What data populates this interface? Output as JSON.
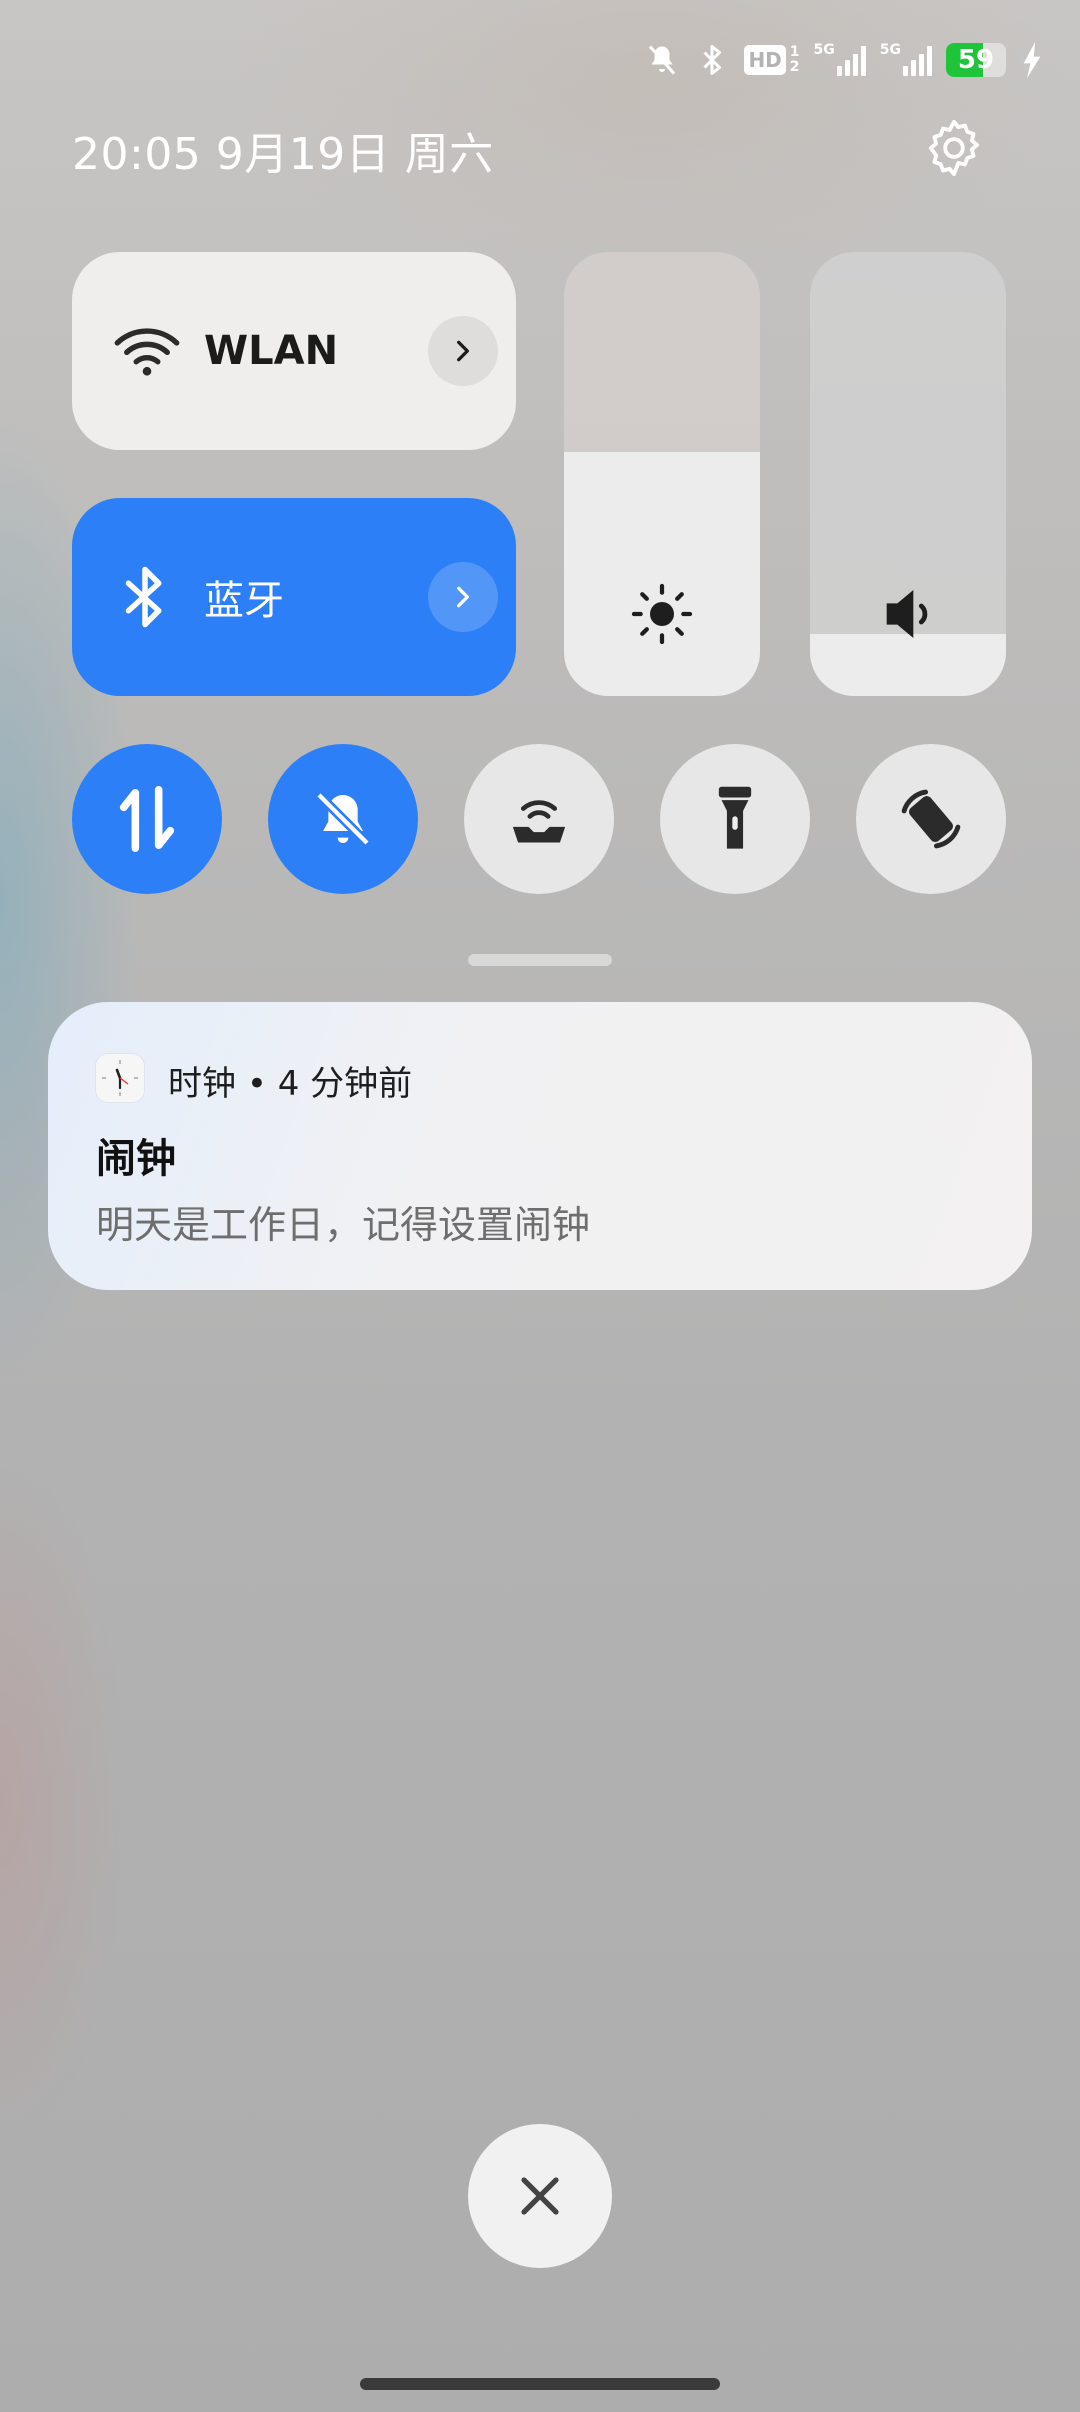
{
  "status_bar": {
    "icons": [
      "mute-icon",
      "bluetooth-icon",
      "hd-icon",
      "signal-5g-icon",
      "signal-5g-icon",
      "battery-icon",
      "charging-icon"
    ],
    "hd_label": "HD",
    "sim_1": "1",
    "sim_2": "2",
    "net_1": "5G",
    "net_2": "5G",
    "battery_percent": "59"
  },
  "header": {
    "datetime": "20:05 9月19日 周六"
  },
  "tiles": {
    "wlan_label": "WLAN",
    "bluetooth_label": "蓝牙"
  },
  "sliders": {
    "brightness_level": 0.55,
    "volume_level": 0.14
  },
  "toggles": [
    {
      "name": "mobile-data",
      "state": "on"
    },
    {
      "name": "silent-mode",
      "state": "on"
    },
    {
      "name": "hotspot",
      "state": "off"
    },
    {
      "name": "flashlight",
      "state": "off"
    },
    {
      "name": "auto-rotate",
      "state": "off"
    }
  ],
  "notification": {
    "app_name": "时钟",
    "separator": "•",
    "time_ago": "4 分钟前",
    "title": "闹钟",
    "body": "明天是工作日，记得设置闹钟"
  },
  "colors": {
    "accent": "#2d7ff7",
    "battery": "#1fc43a"
  }
}
